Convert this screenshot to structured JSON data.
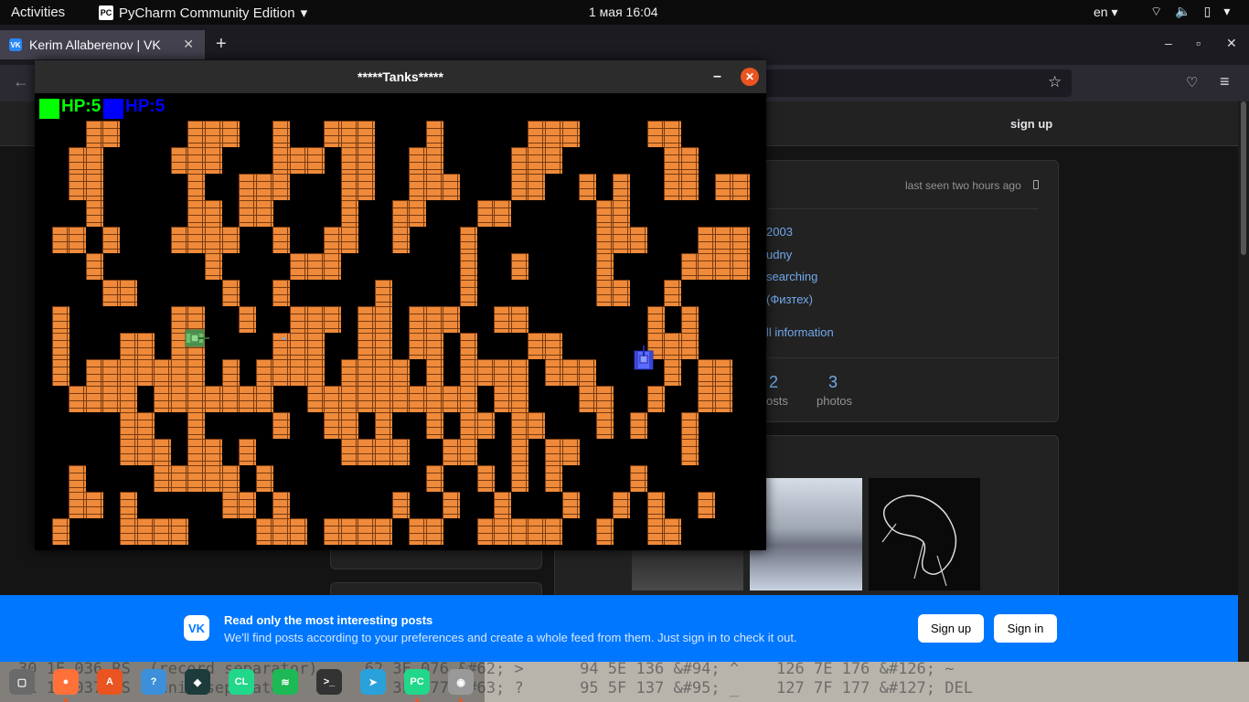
{
  "topbar": {
    "activities": "Activities",
    "app_name": "PyCharm Community Edition",
    "app_badge": "PC",
    "clock": "1 мая  16:04",
    "lang": "en"
  },
  "browser": {
    "tab_title": "Kerim Allaberenov | VK",
    "tab_favicon": "VK",
    "new_tab": "+",
    "close_tab": "✕"
  },
  "vk": {
    "signup_top": "sign up",
    "last_seen": "last seen two hours ago",
    "info_lines": [
      "2003",
      "udny",
      "searching",
      "(Физтех)"
    ],
    "full_info": "ll information",
    "stats": [
      {
        "num": "2",
        "label": "osts"
      },
      {
        "num": "3",
        "label": "photos"
      }
    ]
  },
  "game": {
    "title": "*****Tanks*****",
    "player1_hp": "HP:5",
    "player2_hp": "HP:5",
    "player1_color": "#00ff00",
    "player2_color": "#0000ff",
    "brick_color": "#ee8a3a",
    "map_rows": [
      "...##....###..#..###...#.....###....##.....",
      "..##....###...###.##..##....###......##....",
      "..##.....#..###...##..###...##..#.#..##.##.",
      "...#.....##.##....#..##...##.....##.........",
      ".##.#...####..#..##..#...#.......###...####.",
      "...#......#....###.......#..#....#....####.",
      "....##.....#..#.....#....#.......##..#....",
      ".#......##..#..###.##.###..##.......#.#....",
      ".#...##.##....###..##.##.#...##.....###...",
      ".#.#######.#.####.####.#.####.###....#.##..",
      "..####.#######..##########.##...##..#..##..",
      ".....##..#....#..##.#..#.##.##...#.#..#...",
      ".....###.##.#.....####..##..#.##......#...",
      "..#....#####.#.........#..#.#.#....#.......",
      "..##.#.....##.#......#..#..#...#..#.#..#..",
      ".#...####....###.####.##..#####..#..##...."
    ],
    "tank_green_label": "green-tank",
    "tank_blue_label": "blue-tank"
  },
  "banner": {
    "logo": "VK",
    "title": "Read only the most interesting posts",
    "subtitle": "We'll find posts according to your preferences and create a whole feed from them. Just sign in to check it out.",
    "signup": "Sign up",
    "signin": "Sign in"
  },
  "dock": {
    "bg_text_line1": "30 1E 036 RS  (record separator)     62 3E 076 &#62; >      94 5E 136 &#94; ^    126 7E 176 &#126; ~",
    "bg_text_line2": "31 1F 037 US  (unit separator)       63 3F 077 &#63; ?      95 5F 137 &#95; _    127 7F 177 &#127; DEL",
    "icons": [
      {
        "name": "files-icon",
        "label": "▢",
        "color": "#6a6a6a"
      },
      {
        "name": "firefox-icon",
        "label": "●",
        "color": "#ff7139"
      },
      {
        "name": "software-icon",
        "label": "A",
        "color": "#e95420"
      },
      {
        "name": "help-icon",
        "label": "?",
        "color": "#3c8fd8"
      },
      {
        "name": "gitkraken-icon",
        "label": "◆",
        "color": "#1d3b3b"
      },
      {
        "name": "clion-icon",
        "label": "CL",
        "color": "#21d789"
      },
      {
        "name": "spotify-icon",
        "label": "≋",
        "color": "#1db954"
      },
      {
        "name": "terminal-icon",
        "label": ">_",
        "color": "#333333"
      },
      {
        "name": "telegram-icon",
        "label": "➤",
        "color": "#2aa1da"
      },
      {
        "name": "pycharm-icon",
        "label": "PC",
        "color": "#21d789"
      },
      {
        "name": "image-viewer-icon",
        "label": "◉",
        "color": "#999999"
      }
    ]
  }
}
